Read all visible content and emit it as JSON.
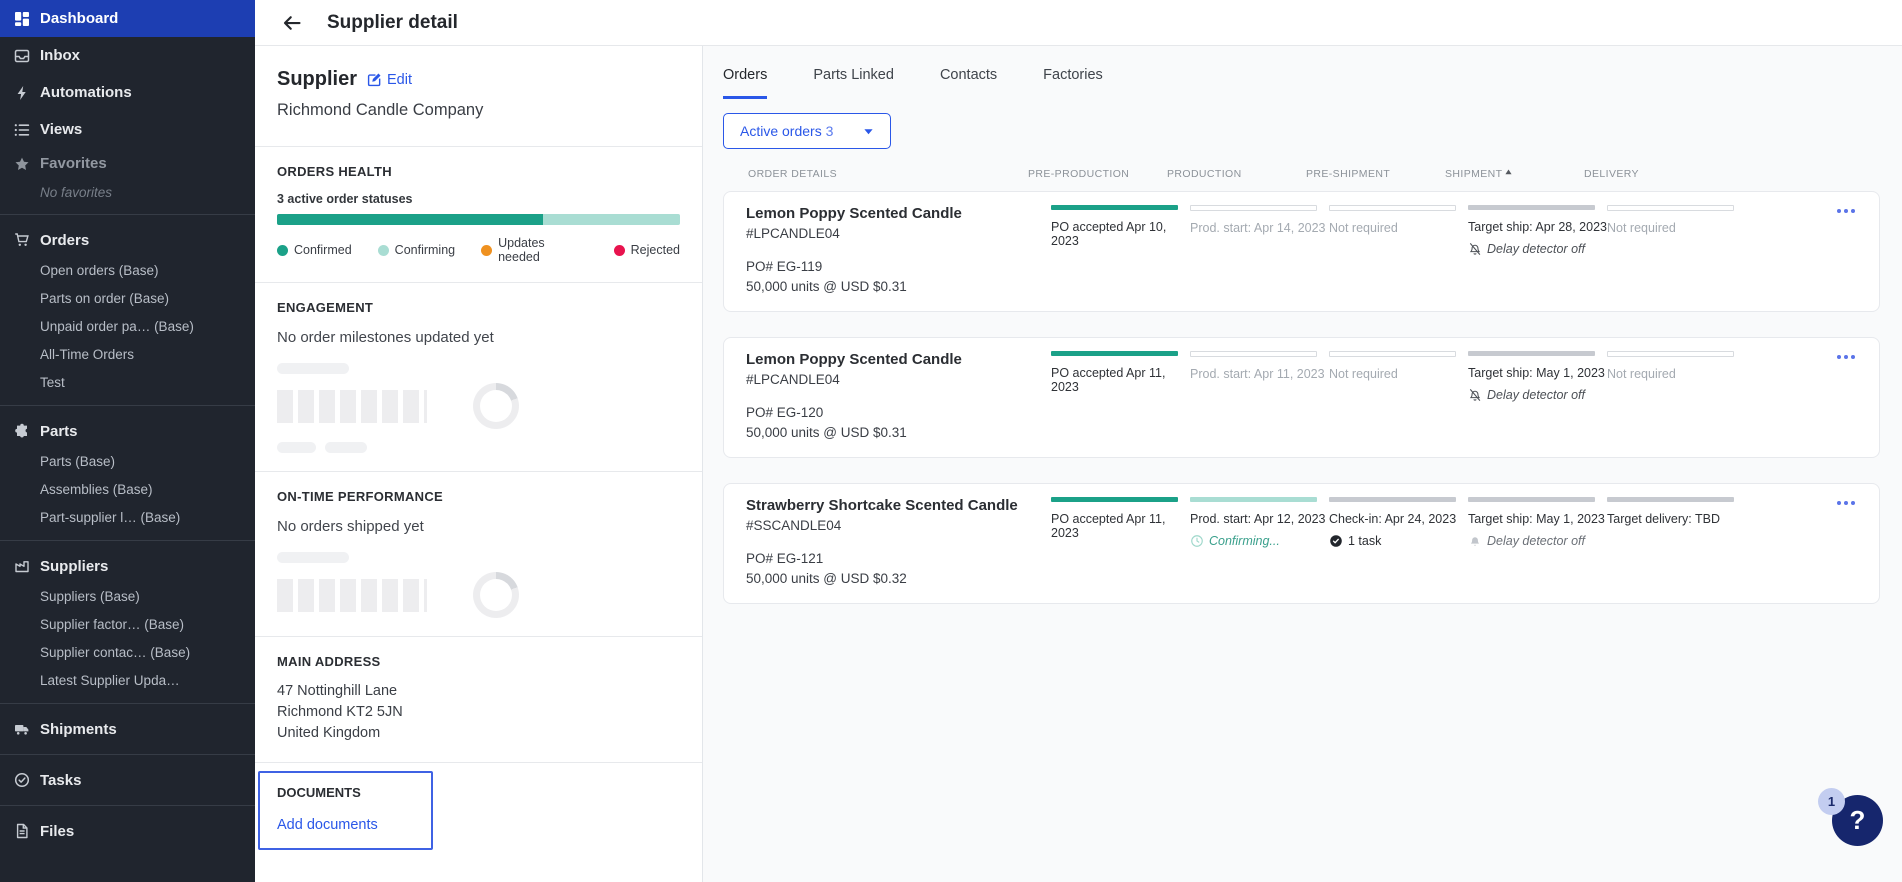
{
  "colors": {
    "accent_blue": "#2a57e8",
    "sidebar_active_blue": "#1d3eb2",
    "confirmed_teal": "#1ba188",
    "confirming_teal": "#a9ddd3",
    "updates_orange": "#ef9120",
    "rejected_red": "#e8134e",
    "help_navy": "#16266d"
  },
  "sidebar": {
    "top": [
      {
        "label": "Dashboard",
        "icon": "dashboard-icon",
        "active": true
      },
      {
        "label": "Inbox",
        "icon": "inbox-icon"
      },
      {
        "label": "Automations",
        "icon": "bolt-icon"
      },
      {
        "label": "Views",
        "icon": "list-icon"
      }
    ],
    "favorites": {
      "label": "Favorites",
      "empty": "No favorites"
    },
    "orders": {
      "label": "Orders",
      "items": [
        "Open orders (Base)",
        "Parts on order (Base)",
        "Unpaid order pa… (Base)",
        "All-Time Orders",
        "Test"
      ]
    },
    "parts": {
      "label": "Parts",
      "items": [
        "Parts (Base)",
        "Assemblies (Base)",
        "Part-supplier l… (Base)"
      ]
    },
    "suppliers": {
      "label": "Suppliers",
      "items": [
        "Suppliers (Base)",
        "Supplier factor… (Base)",
        "Supplier contac… (Base)",
        "Latest Supplier Upda…"
      ]
    },
    "shipments": {
      "label": "Shipments"
    },
    "tasks": {
      "label": "Tasks"
    },
    "files": {
      "label": "Files"
    }
  },
  "header": {
    "title": "Supplier detail"
  },
  "panel": {
    "title": "Supplier",
    "edit_label": "Edit",
    "name": "Richmond Candle Company",
    "orders_health": {
      "heading": "ORDERS HEALTH",
      "subtitle": "3 active order statuses",
      "bar_segments": [
        {
          "label": "Confirmed",
          "color": "#1ba188",
          "pct": 66
        },
        {
          "label": "Confirming",
          "color": "#a9ddd3",
          "pct": 34
        }
      ],
      "legend": [
        {
          "label": "Confirmed",
          "color": "#1ba188"
        },
        {
          "label": "Confirming",
          "color": "#a9ddd3"
        },
        {
          "label": "Updates needed",
          "color": "#ef9120"
        },
        {
          "label": "Rejected",
          "color": "#e8134e"
        }
      ]
    },
    "engagement": {
      "heading": "ENGAGEMENT",
      "empty": "No order milestones updated yet"
    },
    "on_time": {
      "heading": "ON-TIME PERFORMANCE",
      "empty": "No orders shipped yet"
    },
    "address": {
      "heading": "MAIN ADDRESS",
      "lines": [
        "47 Nottinghill Lane",
        "Richmond KT2 5JN",
        "United Kingdom"
      ]
    },
    "documents": {
      "heading": "DOCUMENTS",
      "add_label": "Add documents"
    }
  },
  "main": {
    "tabs": [
      {
        "label": "Orders",
        "active": true
      },
      {
        "label": "Parts Linked"
      },
      {
        "label": "Contacts"
      },
      {
        "label": "Factories"
      }
    ],
    "filter": {
      "label": "Active orders",
      "count": "3"
    },
    "columns": [
      "ORDER DETAILS",
      "PRE-PRODUCTION",
      "PRODUCTION",
      "PRE-SHIPMENT",
      "SHIPMENT",
      "DELIVERY"
    ],
    "sort": {
      "column": "SHIPMENT",
      "direction": "asc"
    },
    "orders": [
      {
        "name": "Lemon Poppy Scented Candle",
        "sku": "#LPCANDLE04",
        "po": "PO# EG-119",
        "units": "50,000 units @ USD $0.31",
        "milestones": [
          {
            "state": "complete",
            "text": "PO accepted Apr 10, 2023"
          },
          {
            "state": "scheduled",
            "text": "Prod. start: Apr 14, 2023"
          },
          {
            "state": "not-required",
            "text": "Not required"
          },
          {
            "state": "pending",
            "text": "Target ship: Apr 28, 2023",
            "sub": "Delay detector off"
          },
          {
            "state": "not-required",
            "text": "Not required"
          }
        ]
      },
      {
        "name": "Lemon Poppy Scented Candle",
        "sku": "#LPCANDLE04",
        "po": "PO# EG-120",
        "units": "50,000 units @ USD $0.31",
        "milestones": [
          {
            "state": "complete",
            "text": "PO accepted Apr 11, 2023"
          },
          {
            "state": "scheduled",
            "text": "Prod. start: Apr 11, 2023"
          },
          {
            "state": "not-required",
            "text": "Not required"
          },
          {
            "state": "pending",
            "text": "Target ship: May 1, 2023",
            "sub": "Delay detector off"
          },
          {
            "state": "not-required",
            "text": "Not required"
          }
        ]
      },
      {
        "name": "Strawberry Shortcake Scented Candle",
        "sku": "#SSCANDLE04",
        "po": "PO# EG-121",
        "units": "50,000 units @ USD $0.32",
        "milestones": [
          {
            "state": "complete",
            "text": "PO accepted Apr 11, 2023"
          },
          {
            "state": "confirming",
            "text": "Prod. start: Apr 12, 2023",
            "sub": "Confirming..."
          },
          {
            "state": "pending",
            "text": "Check-in: Apr 24, 2023",
            "sub": "1 task"
          },
          {
            "state": "pending",
            "text": "Target ship: May 1, 2023",
            "sub": "Delay detector off"
          },
          {
            "state": "pending",
            "text": "Target delivery: TBD"
          }
        ]
      }
    ]
  },
  "help": {
    "badge": "1",
    "label": "?"
  }
}
